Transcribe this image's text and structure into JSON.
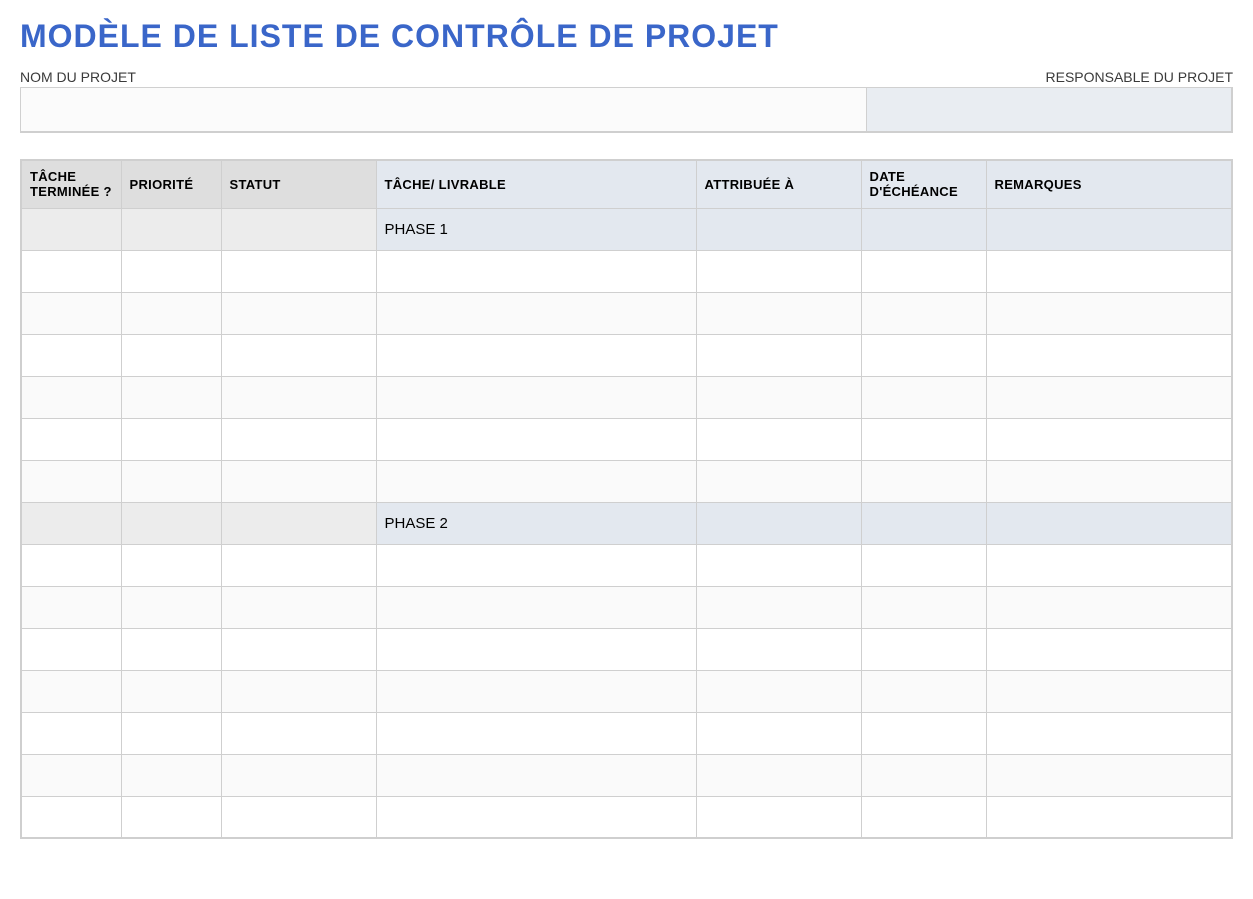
{
  "title": "MODÈLE DE LISTE DE CONTRÔLE DE PROJET",
  "labels": {
    "project_name": "NOM DU PROJET",
    "project_manager": "RESPONSABLE DU PROJET"
  },
  "fields": {
    "project_name": "",
    "project_manager": ""
  },
  "columns": {
    "done": "TÂCHE TERMINÉE ?",
    "priority": "PRIORITÉ",
    "status": "STATUT",
    "task": "TÂCHE/ LIVRABLE",
    "assigned": "ATTRIBUÉE À",
    "due": "DATE D'ÉCHÉANCE",
    "remarks": "REMARQUES"
  },
  "rows": [
    {
      "type": "phase",
      "task": "PHASE 1"
    },
    {
      "type": "data"
    },
    {
      "type": "data"
    },
    {
      "type": "data"
    },
    {
      "type": "data"
    },
    {
      "type": "data"
    },
    {
      "type": "data"
    },
    {
      "type": "phase",
      "task": "PHASE 2"
    },
    {
      "type": "data"
    },
    {
      "type": "data"
    },
    {
      "type": "data"
    },
    {
      "type": "data"
    },
    {
      "type": "data"
    },
    {
      "type": "data"
    },
    {
      "type": "data"
    }
  ]
}
